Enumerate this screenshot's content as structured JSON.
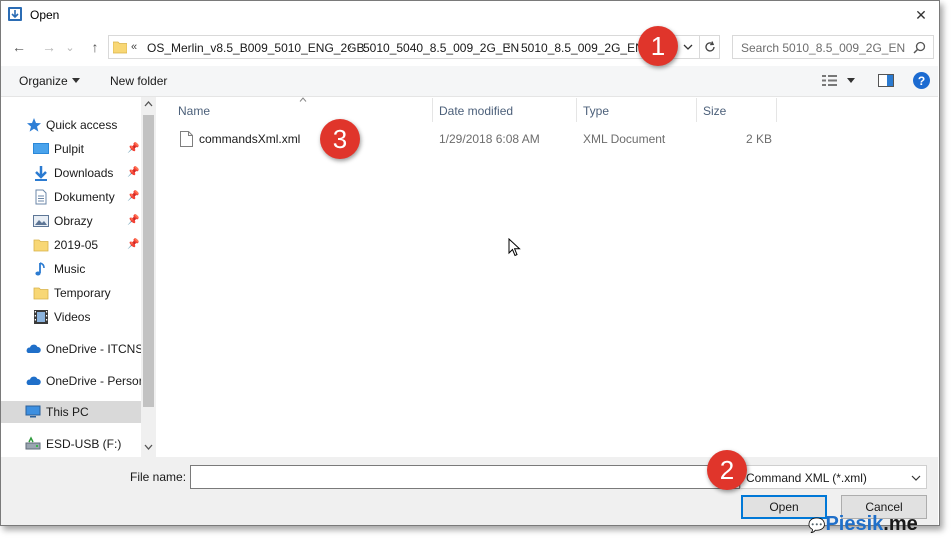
{
  "window": {
    "title": "Open",
    "close_glyph": "✕"
  },
  "nav": {
    "back": "←",
    "forward": "→",
    "recent": "⌄",
    "up": "↑"
  },
  "address": {
    "overflow": "«",
    "crumbs": [
      "OS_Merlin_v8.5_B009_5010_ENG_2GB",
      "5010_5040_8.5_009_2G_EN",
      "5010_8.5_009_2G_EN"
    ],
    "separator": "›"
  },
  "search": {
    "placeholder": "Search 5010_8.5_009_2G_EN"
  },
  "toolbar": {
    "organize": "Organize",
    "new_folder": "New folder",
    "help": "?"
  },
  "sidebar": {
    "items": [
      {
        "label": "Quick access",
        "icon": "star-icon",
        "pinned": false
      },
      {
        "label": "Pulpit",
        "icon": "desktop-icon",
        "pinned": true
      },
      {
        "label": "Downloads",
        "icon": "download-icon",
        "pinned": true
      },
      {
        "label": "Dokumenty",
        "icon": "document-icon",
        "pinned": true
      },
      {
        "label": "Obrazy",
        "icon": "pictures-icon",
        "pinned": true
      },
      {
        "label": "2019-05",
        "icon": "folder-icon",
        "pinned": true
      },
      {
        "label": "Music",
        "icon": "music-icon",
        "pinned": false
      },
      {
        "label": "Temporary",
        "icon": "folder-icon",
        "pinned": false
      },
      {
        "label": "Videos",
        "icon": "video-icon",
        "pinned": false
      },
      {
        "label": "OneDrive - ITCNS.",
        "icon": "cloud-icon",
        "pinned": false
      },
      {
        "label": "OneDrive - Persor",
        "icon": "cloud-icon",
        "pinned": false
      },
      {
        "label": "This PC",
        "icon": "computer-icon",
        "pinned": false
      },
      {
        "label": "ESD-USB (F:)",
        "icon": "usb-drive-icon",
        "pinned": false
      }
    ]
  },
  "columns": {
    "name": "Name",
    "date": "Date modified",
    "type": "Type",
    "size": "Size"
  },
  "files": [
    {
      "name": "commandsXml.xml",
      "date": "1/29/2018 6:08 AM",
      "type": "XML Document",
      "size": "2 KB"
    }
  ],
  "footer": {
    "file_name_label": "File name:",
    "file_name_value": "",
    "filter": "Command XML (*.xml)",
    "open": "Open",
    "cancel": "Cancel"
  },
  "annotations": [
    "1",
    "2",
    "3"
  ],
  "watermark": {
    "prefix": "P",
    "text": "iesik",
    "suffix": ".me"
  },
  "colors": {
    "accent": "#0078d7",
    "badge": "#e0352b",
    "selection": "#cce8ff",
    "folder": "#f8d775"
  }
}
